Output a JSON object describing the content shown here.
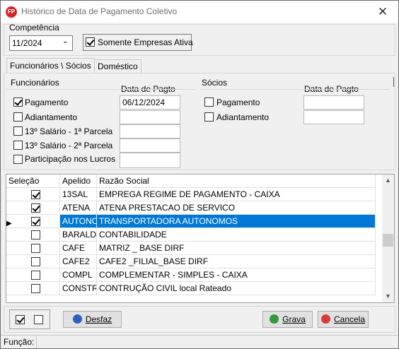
{
  "window": {
    "title": "Histórico de Data de Pagamento Coletivo",
    "app_icon": "FP",
    "close_glyph": "✕"
  },
  "competencia": {
    "label": "Competência",
    "value": "11/2024",
    "somente_label": "Somente Empresas Ativa",
    "somente_checked": true
  },
  "tabs": [
    {
      "label": "Funcionários \\ Sócios",
      "active": true
    },
    {
      "label": "Doméstico",
      "active": false
    }
  ],
  "funcionarios": {
    "label": "Funcionários",
    "data_label": "Data de Pagto",
    "items": [
      {
        "label": "Pagamento",
        "checked": true,
        "date": "06/12/2024"
      },
      {
        "label": "Adiantamento",
        "checked": false,
        "date": ""
      },
      {
        "label": "13º Salário - 1ª Parcela",
        "checked": false,
        "date": ""
      },
      {
        "label": "13º Salário - 2ª Parcela",
        "checked": false,
        "date": ""
      },
      {
        "label": "Participação nos Lucros",
        "checked": false,
        "date": ""
      }
    ]
  },
  "socios": {
    "label": "Sócios",
    "data_label": "Data de Pagto",
    "items": [
      {
        "label": "Pagamento",
        "checked": false,
        "date": ""
      },
      {
        "label": "Adiantamento",
        "checked": false,
        "date": ""
      }
    ]
  },
  "table": {
    "headers": [
      "Seleção",
      "Apelido",
      "Razão Social"
    ],
    "rows": [
      {
        "checked": true,
        "apelido": "13SAL",
        "razao": "EMPREGA REGIME DE PAGAMENTO - CAIXA",
        "selected": false
      },
      {
        "checked": true,
        "apelido": "ATENA",
        "razao": "ATENA PRESTACAO DE SERVICO",
        "selected": false
      },
      {
        "checked": true,
        "apelido": "AUTONO",
        "razao": "TRANSPORTADORA AUTONOMOS",
        "selected": true
      },
      {
        "checked": false,
        "apelido": "BARALDI",
        "razao": "CONTABILIDADE",
        "selected": false
      },
      {
        "checked": false,
        "apelido": "CAFE",
        "razao": "MATRIZ _ BASE DIRF",
        "selected": false
      },
      {
        "checked": false,
        "apelido": "CAFE2",
        "razao": "CAFE2 _FILIAL_BASE DIRF",
        "selected": false
      },
      {
        "checked": false,
        "apelido": "COMPL",
        "razao": "COMPLEMENTAR  - SIMPLES - CAIXA",
        "selected": false
      },
      {
        "checked": false,
        "apelido": "CONSTR",
        "razao": "CONTRUÇÃO CIVIL local Rateado",
        "selected": false
      }
    ]
  },
  "buttons": {
    "desfaz": "Desfaz",
    "grava": "Grava",
    "cancela": "Cancela"
  },
  "status": {
    "label": "Função:"
  },
  "colors": {
    "selection": "#0078d7",
    "grava_icon": "#2e9a3a",
    "cancela_icon": "#d83b3b",
    "desfaz_icon": "#2b5fbd"
  }
}
